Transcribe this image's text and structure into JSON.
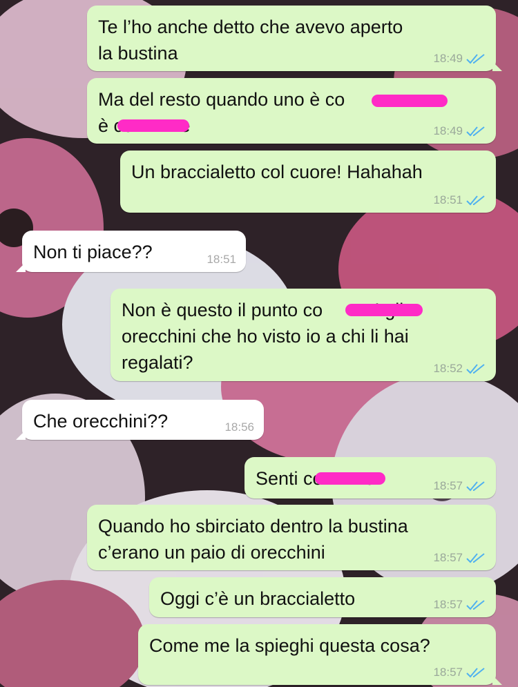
{
  "chat": {
    "messages": [
      {
        "direction": "out",
        "lines": "Te l’ho anche detto che avevo aperto\nla bustina",
        "time": "18:49",
        "status": "read"
      },
      {
        "direction": "out",
        "lines": "Ma del resto quando uno è co         e\nè co         e",
        "time": "18:49",
        "status": "read"
      },
      {
        "direction": "out",
        "lines": "Un braccialetto col cuore! Hahahah",
        "time": "18:51",
        "status": "read"
      },
      {
        "direction": "in",
        "lines": "Non ti piace??",
        "time": "18:51"
      },
      {
        "direction": "out",
        "lines": "Non è questo il punto co          ! gli\norecchini che ho visto io a chi li hai\nregalati?",
        "time": "18:52",
        "status": "read"
      },
      {
        "direction": "in",
        "lines": "Che orecchini??",
        "time": "18:56"
      },
      {
        "direction": "out",
        "lines": "Senti co        e",
        "time": "18:57",
        "status": "read"
      },
      {
        "direction": "out",
        "lines": "Quando ho sbirciato dentro la bustina\nc’erano un paio di orecchini",
        "time": "18:57",
        "status": "read"
      },
      {
        "direction": "out",
        "lines": "Oggi c’è un braccialetto",
        "time": "18:57",
        "status": "read"
      },
      {
        "direction": "out",
        "lines": "Come me la spieghi questa cosa?",
        "time": "18:57",
        "status": "read"
      }
    ]
  },
  "colors": {
    "outgoing_bubble": "#dcf8c6",
    "incoming_bubble": "#ffffff",
    "read_ticks": "#4fb0f0",
    "redaction": "#ff2bc6"
  },
  "icons": {
    "read_status": "double-check-icon"
  }
}
